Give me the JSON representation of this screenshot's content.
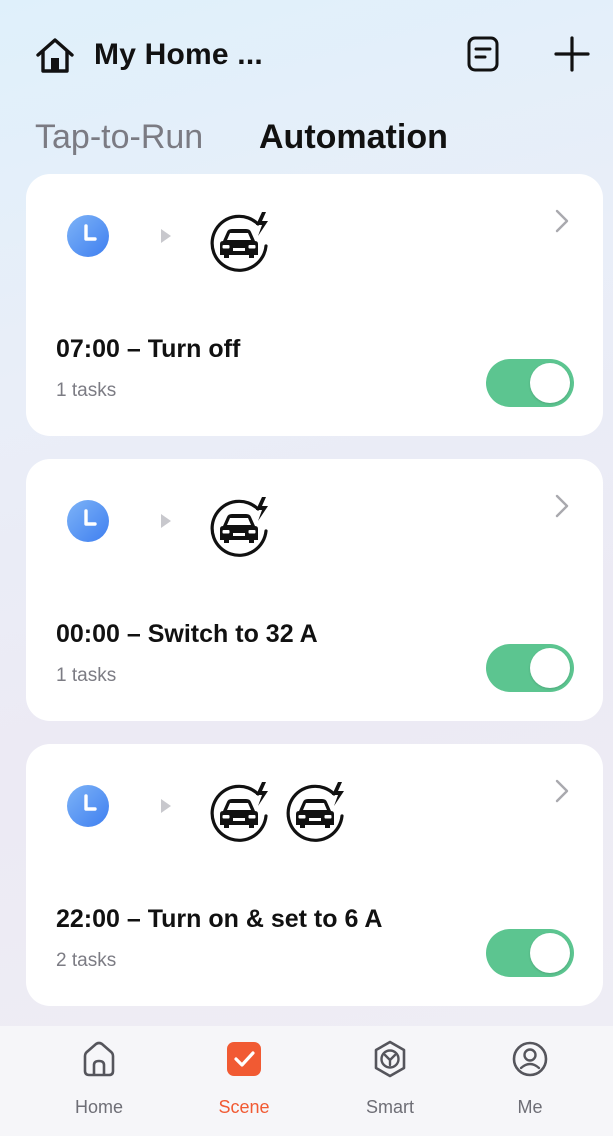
{
  "header": {
    "home_title": "My Home ...",
    "icons": {
      "home": "home-icon",
      "notes": "notes-icon",
      "add": "plus-icon"
    }
  },
  "tabs": [
    {
      "label": "Tap-to-Run",
      "active": false
    },
    {
      "label": "Automation",
      "active": true
    }
  ],
  "automations": [
    {
      "title": "07:00 – Turn off",
      "tasks": "1 tasks",
      "enabled": true,
      "trigger_icon": "clock-icon",
      "action_icons": [
        "ev-charger-car-icon"
      ]
    },
    {
      "title": "00:00 – Switch to 32 A",
      "tasks": "1 tasks",
      "enabled": true,
      "trigger_icon": "clock-icon",
      "action_icons": [
        "ev-charger-car-icon"
      ]
    },
    {
      "title": "22:00 – Turn on & set to 6 A",
      "tasks": "2 tasks",
      "enabled": true,
      "trigger_icon": "clock-icon",
      "action_icons": [
        "ev-charger-car-icon",
        "ev-charger-car-icon"
      ]
    }
  ],
  "bottom_nav": [
    {
      "label": "Home",
      "icon": "home-icon",
      "active": false
    },
    {
      "label": "Scene",
      "icon": "scene-checkbox-icon",
      "active": true
    },
    {
      "label": "Smart",
      "icon": "smart-icon",
      "active": false
    },
    {
      "label": "Me",
      "icon": "profile-icon",
      "active": false
    }
  ],
  "colors": {
    "toggle_on": "#5cc590",
    "clock_blue": "#4d8ff0",
    "active_tab": "#f15a33",
    "inactive_text": "#7b7b83"
  }
}
